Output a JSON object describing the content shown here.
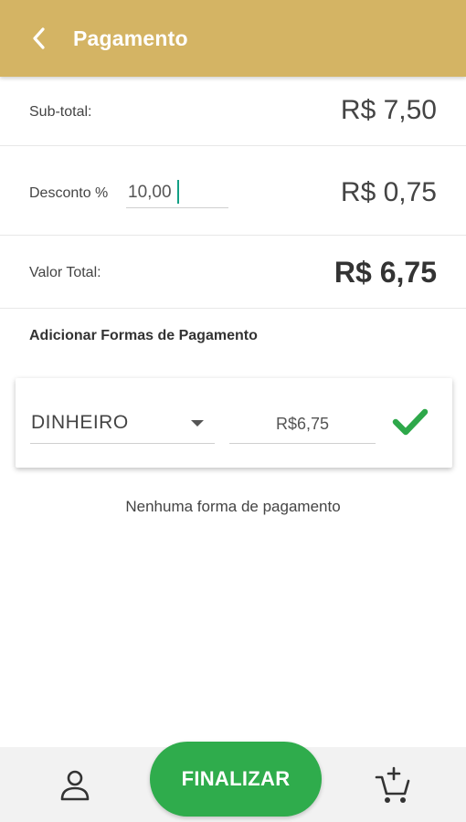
{
  "header": {
    "title": "Pagamento",
    "back_icon": "chevron-left-icon",
    "background_color": "#d4b464"
  },
  "summary": {
    "subtotal_label": "Sub-total:",
    "subtotal_value": "R$ 7,50",
    "discount_label": "Desconto %",
    "discount_input_value": "10,00",
    "discount_value": "R$ 0,75",
    "total_label": "Valor Total:",
    "total_value": "R$ 6,75"
  },
  "payment": {
    "section_title": "Adicionar Formas de Pagamento",
    "method_selected": "DINHEIRO",
    "amount_value": "R$6,75",
    "confirm_icon": "checkmark-icon",
    "confirm_color": "#2ea84a",
    "empty_message": "Nenhuma forma de pagamento"
  },
  "bottom_bar": {
    "finalize_label": "FINALIZAR",
    "finalize_color": "#2fac4c",
    "person_icon": "person-icon",
    "cart_icon": "add-to-cart-icon"
  }
}
